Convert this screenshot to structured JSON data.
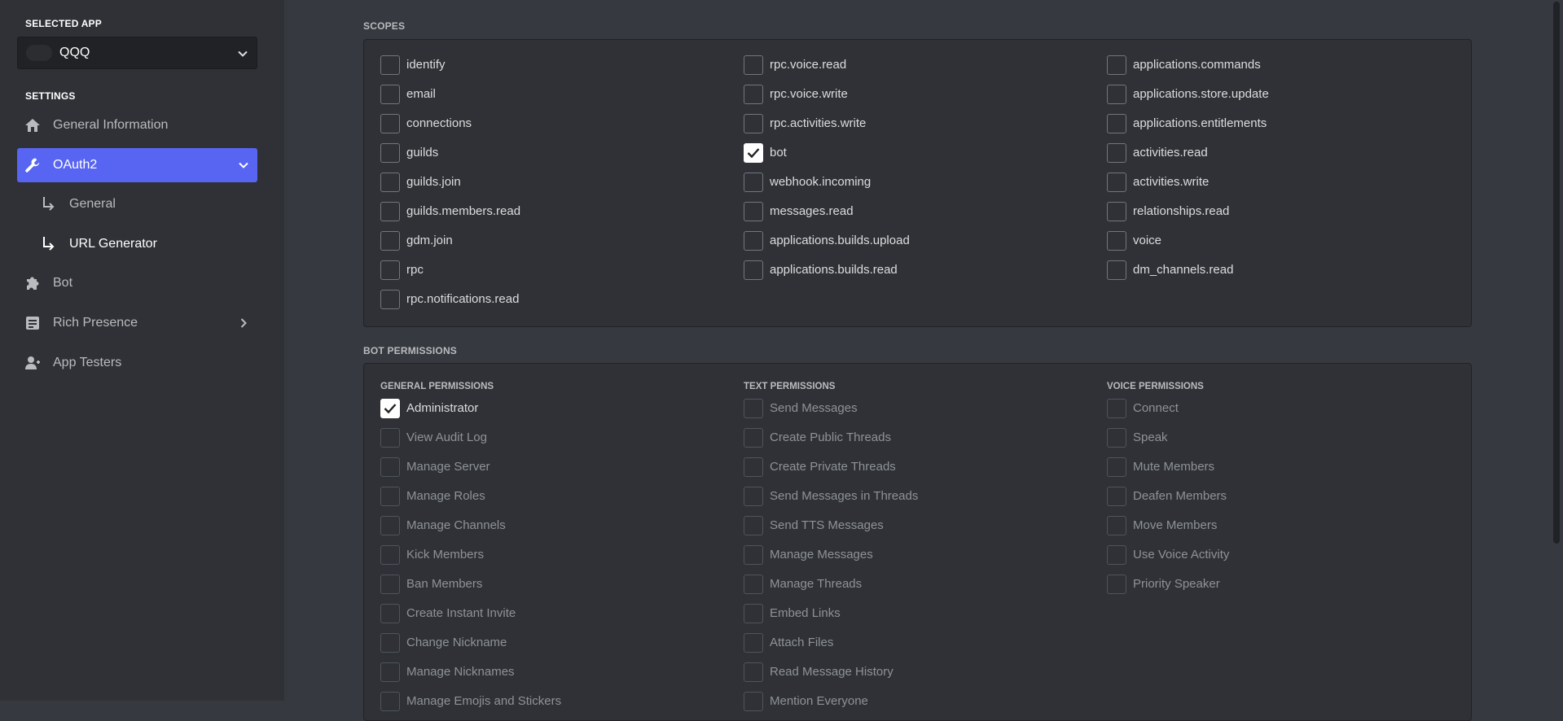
{
  "sidebar": {
    "selected_app_heading": "SELECTED APP",
    "selected_app_name": "QQQ",
    "settings_heading": "SETTINGS",
    "items": [
      {
        "label": "General Information",
        "icon": "home-icon"
      },
      {
        "label": "OAuth2",
        "icon": "wrench-icon",
        "active": true
      },
      {
        "label": "Bot",
        "icon": "puzzle-icon"
      },
      {
        "label": "Rich Presence",
        "icon": "document-icon"
      },
      {
        "label": "App Testers",
        "icon": "person-icon"
      }
    ],
    "oauth_sub_items": [
      {
        "label": "General"
      },
      {
        "label": "URL Generator",
        "current": true
      }
    ]
  },
  "scopes": {
    "heading": "SCOPES",
    "columns": [
      [
        {
          "label": "identify",
          "checked": false
        },
        {
          "label": "email",
          "checked": false
        },
        {
          "label": "connections",
          "checked": false
        },
        {
          "label": "guilds",
          "checked": false
        },
        {
          "label": "guilds.join",
          "checked": false
        },
        {
          "label": "guilds.members.read",
          "checked": false
        },
        {
          "label": "gdm.join",
          "checked": false
        },
        {
          "label": "rpc",
          "checked": false
        },
        {
          "label": "rpc.notifications.read",
          "checked": false
        }
      ],
      [
        {
          "label": "rpc.voice.read",
          "checked": false
        },
        {
          "label": "rpc.voice.write",
          "checked": false
        },
        {
          "label": "rpc.activities.write",
          "checked": false
        },
        {
          "label": "bot",
          "checked": true
        },
        {
          "label": "webhook.incoming",
          "checked": false
        },
        {
          "label": "messages.read",
          "checked": false
        },
        {
          "label": "applications.builds.upload",
          "checked": false
        },
        {
          "label": "applications.builds.read",
          "checked": false
        }
      ],
      [
        {
          "label": "applications.commands",
          "checked": false
        },
        {
          "label": "applications.store.update",
          "checked": false
        },
        {
          "label": "applications.entitlements",
          "checked": false
        },
        {
          "label": "activities.read",
          "checked": false
        },
        {
          "label": "activities.write",
          "checked": false
        },
        {
          "label": "relationships.read",
          "checked": false
        },
        {
          "label": "voice",
          "checked": false
        },
        {
          "label": "dm_channels.read",
          "checked": false
        }
      ]
    ]
  },
  "bot_permissions": {
    "heading": "BOT PERMISSIONS",
    "columns": [
      {
        "title": "GENERAL PERMISSIONS",
        "items": [
          {
            "label": "Administrator",
            "checked": true
          },
          {
            "label": "View Audit Log",
            "checked": false
          },
          {
            "label": "Manage Server",
            "checked": false
          },
          {
            "label": "Manage Roles",
            "checked": false
          },
          {
            "label": "Manage Channels",
            "checked": false
          },
          {
            "label": "Kick Members",
            "checked": false
          },
          {
            "label": "Ban Members",
            "checked": false
          },
          {
            "label": "Create Instant Invite",
            "checked": false
          },
          {
            "label": "Change Nickname",
            "checked": false
          },
          {
            "label": "Manage Nicknames",
            "checked": false
          },
          {
            "label": "Manage Emojis and Stickers",
            "checked": false
          }
        ]
      },
      {
        "title": "TEXT PERMISSIONS",
        "items": [
          {
            "label": "Send Messages",
            "checked": false
          },
          {
            "label": "Create Public Threads",
            "checked": false
          },
          {
            "label": "Create Private Threads",
            "checked": false
          },
          {
            "label": "Send Messages in Threads",
            "checked": false
          },
          {
            "label": "Send TTS Messages",
            "checked": false
          },
          {
            "label": "Manage Messages",
            "checked": false
          },
          {
            "label": "Manage Threads",
            "checked": false
          },
          {
            "label": "Embed Links",
            "checked": false
          },
          {
            "label": "Attach Files",
            "checked": false
          },
          {
            "label": "Read Message History",
            "checked": false
          },
          {
            "label": "Mention Everyone",
            "checked": false
          }
        ]
      },
      {
        "title": "VOICE PERMISSIONS",
        "items": [
          {
            "label": "Connect",
            "checked": false
          },
          {
            "label": "Speak",
            "checked": false
          },
          {
            "label": "Mute Members",
            "checked": false
          },
          {
            "label": "Deafen Members",
            "checked": false
          },
          {
            "label": "Move Members",
            "checked": false
          },
          {
            "label": "Use Voice Activity",
            "checked": false
          },
          {
            "label": "Priority Speaker",
            "checked": false
          }
        ]
      }
    ]
  },
  "colors": {
    "accent": "#5865f2",
    "sidebar_bg": "#2f3136",
    "main_bg": "#36393f"
  }
}
